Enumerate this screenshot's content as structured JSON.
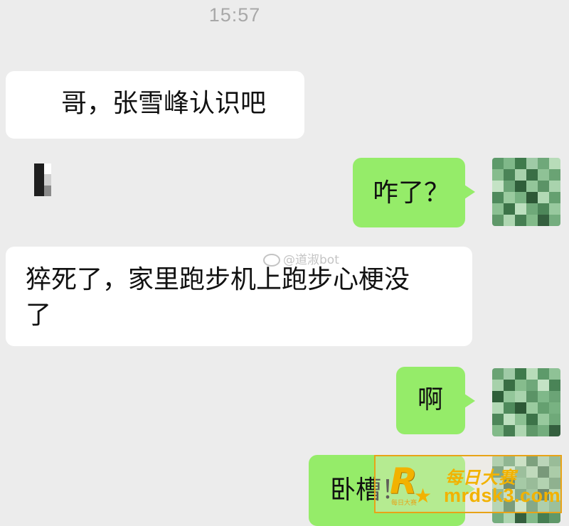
{
  "chat": {
    "timestamp": "15:57",
    "messages": [
      {
        "direction": "in",
        "text": "哥，张雪峰认识吧"
      },
      {
        "direction": "out",
        "text": "咋了？"
      },
      {
        "direction": "in",
        "text_line1": "猝死了，家里跑步机上跑步心梗没",
        "text_line2": "了"
      },
      {
        "direction": "out",
        "text": "啊"
      },
      {
        "direction": "out",
        "text": "卧槽！"
      }
    ]
  },
  "watermarks": {
    "weibo_handle": "@道淑bot",
    "site_name": "每日大赛",
    "site_url": "mrdsk3.com",
    "site_logo_letter": "R",
    "site_logo_sub": "每日大赛"
  },
  "colors": {
    "background": "#ececec",
    "incoming_bubble": "#ffffff",
    "outgoing_bubble": "#95ec69",
    "timestamp_text": "#a8a8a8",
    "watermark_gold": "#f2b200"
  },
  "icons": {
    "avatar_self": "pixelated-avatar-icon",
    "avatar_contact": "pixelated-avatar-icon",
    "weibo": "weibo-icon",
    "site_star": "star-icon"
  }
}
